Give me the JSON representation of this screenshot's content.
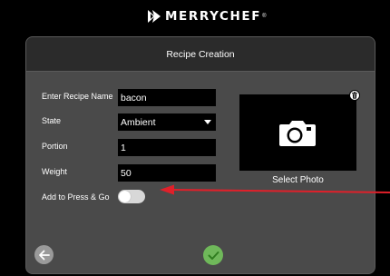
{
  "brand": {
    "name": "MERRYCHEF",
    "reg_mark": "®"
  },
  "screen": {
    "title": "Recipe Creation"
  },
  "form": {
    "recipe_name": {
      "label": "Enter Recipe Name",
      "value": "bacon"
    },
    "state": {
      "label": "State",
      "value": "Ambient"
    },
    "portion": {
      "label": "Portion",
      "value": "1"
    },
    "weight": {
      "label": "Weight",
      "value": "50"
    },
    "press_and_go": {
      "label": "Add to Press & Go",
      "enabled": false
    }
  },
  "photo": {
    "label": "Select Photo",
    "icon": "camera-icon",
    "delete_icon": "trash-icon"
  },
  "footer": {
    "back_icon": "arrow-left-icon",
    "confirm_icon": "checkmark-icon"
  },
  "colors": {
    "panel": "#4a4a4a",
    "header": "#2b2b2b",
    "confirm": "#6fb85a",
    "back": "#9a9a9a",
    "annotation_arrow": "#e0202a"
  }
}
